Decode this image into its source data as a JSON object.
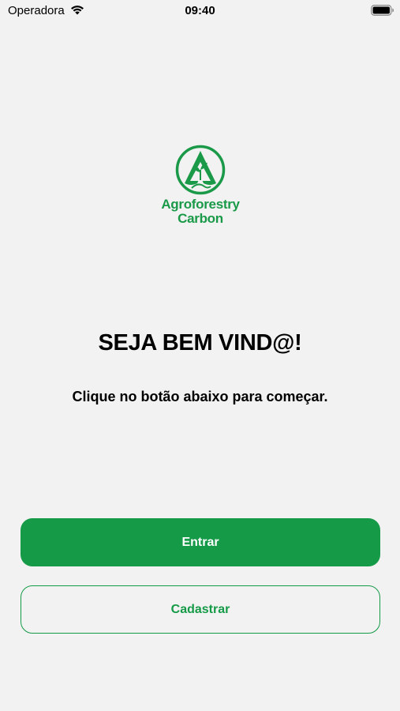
{
  "status_bar": {
    "carrier": "Operadora",
    "time": "09:40",
    "icons": [
      "wifi-icon",
      "battery-icon"
    ]
  },
  "logo": {
    "line1": "Agroforestry",
    "line2": "Carbon",
    "brand_color": "#1a9a48"
  },
  "welcome": {
    "title": "SEJA BEM VIND@!",
    "subtitle": "Clique no botão abaixo para começar."
  },
  "buttons": {
    "primary_label": "Entrar",
    "secondary_label": "Cadastrar"
  },
  "colors": {
    "background": "#f2f2f2",
    "accent": "#159a47"
  }
}
